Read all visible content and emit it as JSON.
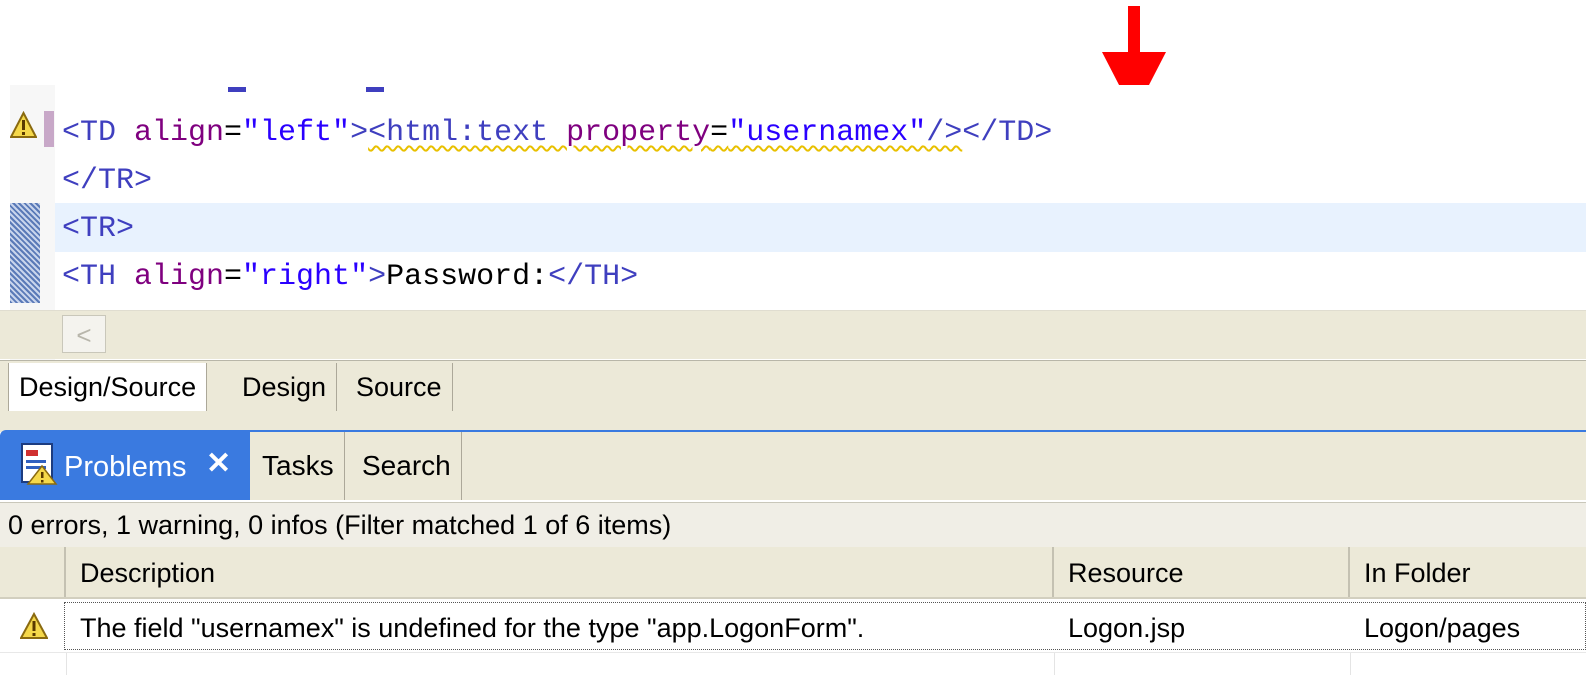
{
  "editor": {
    "lines": {
      "line1": {
        "t1": "<TD ",
        "a1": "align",
        "e1": "=",
        "s1": "\"left\"",
        "t2": ">",
        "t3": "<html:text ",
        "a2": "property",
        "e2": "=",
        "s2": "\"usernamex\"",
        "t4": "/>",
        "t5": "</TD>"
      },
      "line2": {
        "t1": "</TR>"
      },
      "line3": {
        "t1": "<TR>"
      },
      "line4": {
        "t1": "<TH ",
        "a1": "align",
        "e1": "=",
        "s1": "\"right\"",
        "t2": ">",
        "txt": "Password:",
        "t3": "</TH>"
      }
    },
    "scroll_left_glyph": "<"
  },
  "editor_tabs": {
    "design_source": "Design/Source",
    "design": "Design",
    "source": "Source"
  },
  "view_tabs": {
    "problems": "Problems",
    "close_glyph": "✕",
    "tasks": "Tasks",
    "search": "Search"
  },
  "problems": {
    "summary": "0 errors, 1 warning, 0 infos (Filter matched 1 of 6 items)",
    "columns": {
      "description": "Description",
      "resource": "Resource",
      "in_folder": "In Folder"
    },
    "rows": [
      {
        "severity_icon": "warning-icon",
        "description": "The field \"usernamex\" is undefined for the type \"app.LogonForm\".",
        "resource": "Logon.jsp",
        "in_folder": "Logon/pages"
      }
    ]
  },
  "colors": {
    "tag": "#3f3fbf",
    "attribute": "#7f007f",
    "string": "#2a00ff",
    "current_line": "#e8f2fe",
    "view_tab_active": "#3a7ae0",
    "annotation_arrow": "#ff0000"
  }
}
